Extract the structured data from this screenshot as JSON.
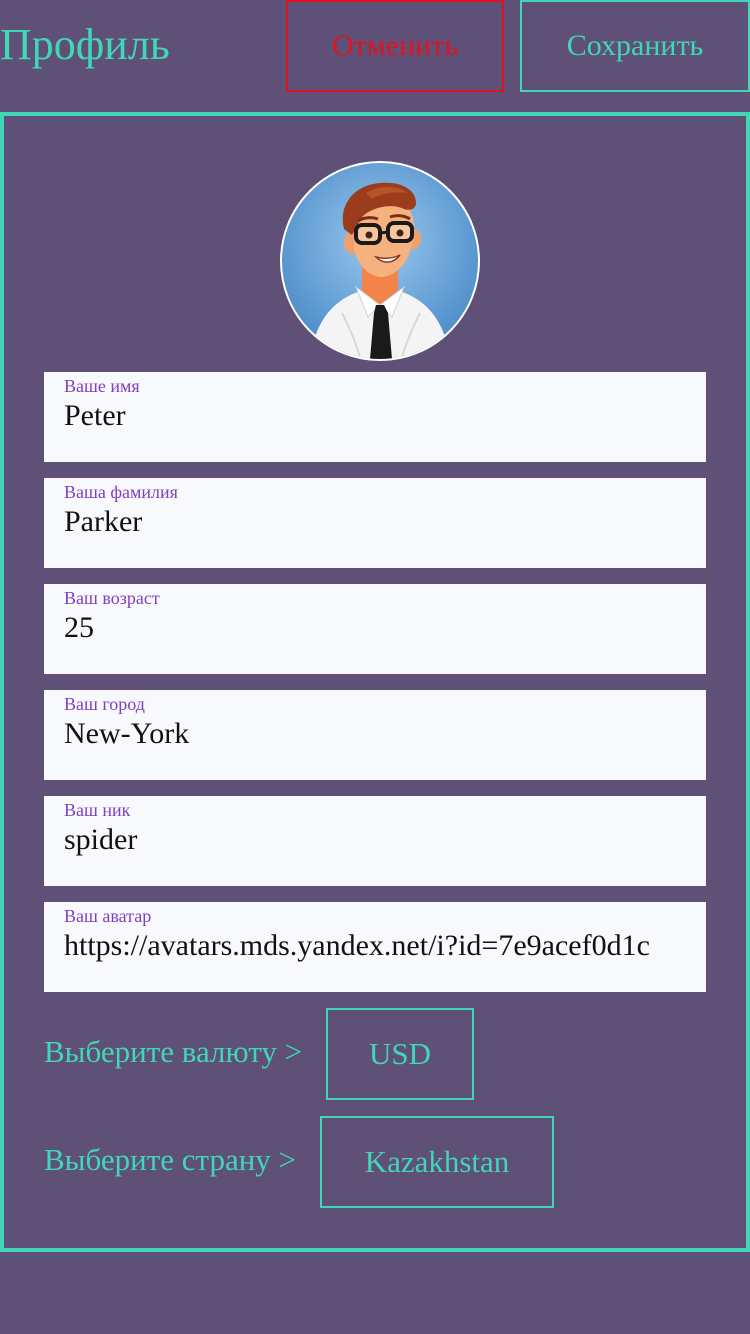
{
  "header": {
    "title": "Профиль",
    "cancel_label": "Отменить",
    "save_label": "Сохранить"
  },
  "profile": {
    "avatar_icon": "user-avatar-cartoon-man-glasses",
    "fields": [
      {
        "label": "Ваше имя",
        "value": "Peter"
      },
      {
        "label": "Ваша фамилия",
        "value": "Parker"
      },
      {
        "label": "Ваш возраст",
        "value": "25"
      },
      {
        "label": "Ваш город",
        "value": "New-York"
      },
      {
        "label": "Ваш ник",
        "value": "spider"
      },
      {
        "label": "Ваш аватар",
        "value": "https://avatars.mds.yandex.net/i?id=7e9acef0d1c"
      }
    ],
    "currency": {
      "label": "Выберите валюту >",
      "value": "USD"
    },
    "country": {
      "label": "Выберите страну >",
      "value": "Kazakhstan"
    }
  },
  "colors": {
    "background": "#5f5077",
    "accent": "#40d6b6",
    "cancel": "#e0121f",
    "field_label": "#7f3fbe",
    "field_bg": "#f7f9fd"
  }
}
